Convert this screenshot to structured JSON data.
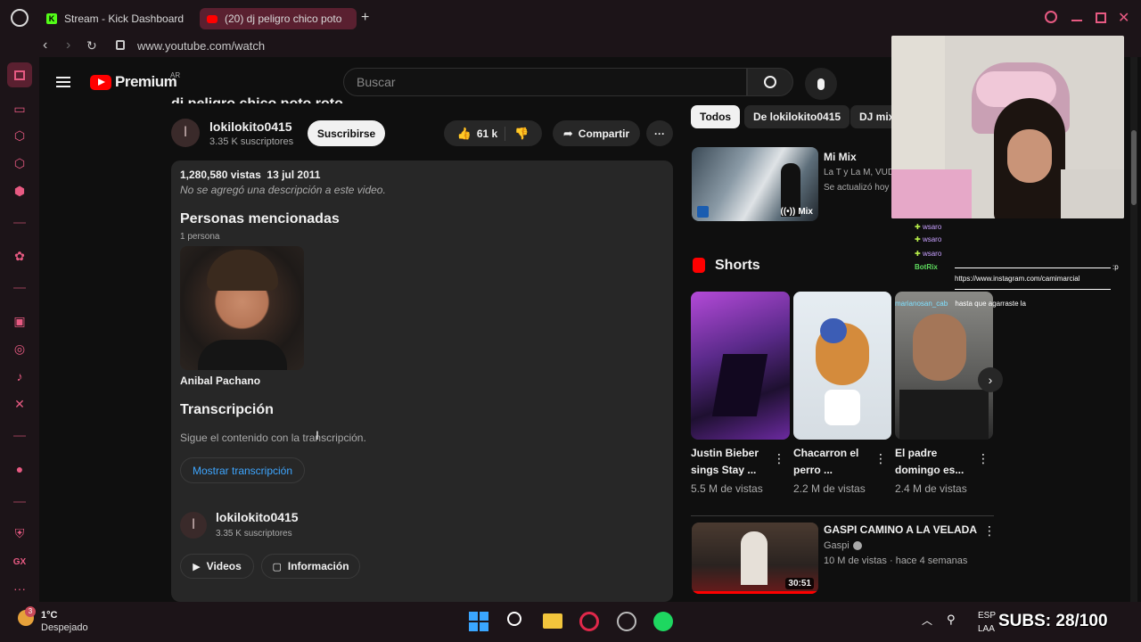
{
  "browser": {
    "tabs": [
      {
        "label": "Stream - Kick Dashboard"
      },
      {
        "label": "(20) dj peligro chico poto"
      }
    ],
    "new_tab": "+",
    "url": "www.youtube.com/watch"
  },
  "youtube": {
    "logo": "Premium",
    "logo_region": "AR",
    "search_placeholder": "Buscar",
    "video_title_partial": "dj peligro chico poto roto",
    "channel": {
      "avatar_letter": "l",
      "name": "lokilokito0415",
      "subs": "3.35 K suscriptores",
      "subscribe": "Suscribirse",
      "likes": "61 k",
      "share": "Compartir",
      "more": "···"
    },
    "description": {
      "stats": "1,280,580 vistas  13 jul 2011",
      "no_desc": "No se agregó una descripción a este video.",
      "people_heading": "Personas mencionadas",
      "people_count": "1 persona",
      "person_name": "Anibal Pachano",
      "transcript_heading": "Transcripción",
      "transcript_sub": "Sigue el contenido con la transcripción.",
      "transcript_btn": "Mostrar transcripción",
      "channel2_letter": "l",
      "channel2_name": "lokilokito0415",
      "channel2_subs": "3.35 K suscriptores",
      "videos_btn": "Videos",
      "info_btn": "Información"
    },
    "chips": [
      "Todos",
      "De lokilokito0415",
      "DJ mix"
    ],
    "mix": {
      "title": "Mi Mix",
      "line1": "La T y La M, VUD",
      "line2": "Se actualizó hoy",
      "badge": "Mix"
    },
    "shorts_heading": "Shorts",
    "shorts": [
      {
        "title": "Justin Bieber sings Stay ...",
        "views": "5.5 M de vistas"
      },
      {
        "title": "Chacarron el perro ...",
        "views": "2.2 M de vistas"
      },
      {
        "title": "El padre domingo es...",
        "views": "2.4 M de vistas"
      }
    ],
    "next_video": {
      "title": "GASPI CAMINO A LA VELADA",
      "channel": "Gaspi",
      "meta": "10 M de vistas · hace 4 semanas",
      "duration": "30:51"
    }
  },
  "chat": [
    {
      "user": "wsaro",
      "text": ""
    },
    {
      "user": "wsaro",
      "text": ""
    },
    {
      "user": "wsaro",
      "text": ""
    },
    {
      "user": "BotRix",
      "text": ":p"
    },
    {
      "user": "",
      "text": "https://www.instagram.com/camimarcial"
    },
    {
      "user": "marianosan_cab",
      "text": "hasta que agarraste la"
    }
  ],
  "taskbar": {
    "temp": "1°C",
    "weather": "Despejado",
    "badge": "3",
    "lang1": "ESP",
    "lang2": "LAA",
    "subs_overlay": "SUBS: 28/100"
  },
  "colors": {
    "accent": "#e75a82",
    "youtube_red": "#ff0000",
    "link_blue": "#3ea6ff"
  }
}
